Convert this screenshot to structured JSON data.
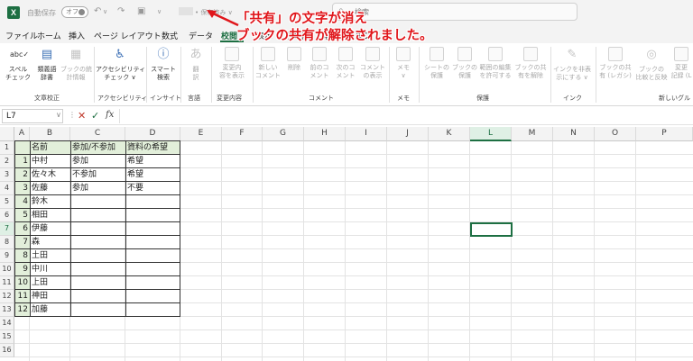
{
  "titlebar": {
    "app_letter": "X",
    "autosave_label": "自動保存",
    "autosave_state": "オフ",
    "save_status": "• 保存済み ∨",
    "search_placeholder": "検索"
  },
  "tabs": [
    "ファイル",
    "ホーム",
    "挿入",
    "ページ レイアウト",
    "数式",
    "データ",
    "校閲",
    "表示",
    "自動化",
    "開発",
    "ヘルプ"
  ],
  "active_tab": "校閲",
  "ribbon": {
    "spell": "スペル\nチェック",
    "thesaurus": "類義語\n辞書",
    "workbook_stats": "ブックの統\n計情報",
    "accessibility": "アクセシビリティ\nチェック ∨",
    "smart_lookup": "スマート\n検索",
    "translate": "翻\n訳",
    "show_changes": "変更内\n容を表示",
    "new_comment": "新しい\nコメント",
    "delete": "削除",
    "prev_comment": "前のコ\nメント",
    "next_comment": "次のコ\nメント",
    "show_comments": "コメント\nの表示",
    "notes": "メモ\n∨",
    "protect_sheet": "シートの\n保護",
    "protect_workbook": "ブックの\n保護",
    "allow_edit_ranges": "範囲の編集\nを許可する",
    "unshare_workbook": "ブックの共\n有を解除",
    "hide_ink": "インクを非表\n示にする ∨",
    "share_legacy": "ブックの共\n有 (レガシ)",
    "compare_merge": "ブックの\n比較と反映",
    "track_changes": "変更\n記録 (L",
    "groups": {
      "proofing": "文章校正",
      "accessibility": "アクセシビリティ",
      "insights": "インサイト",
      "language": "言語",
      "changes": "変更内容",
      "comments": "コメント",
      "notes": "メモ",
      "protect": "保護",
      "ink": "インク",
      "new_group": "新しいグル"
    }
  },
  "formula_bar": {
    "name_box": "L7",
    "fx": "fx",
    "value": ""
  },
  "columns": [
    "A",
    "B",
    "C",
    "D",
    "E",
    "F",
    "G",
    "H",
    "I",
    "J",
    "K",
    "L",
    "M",
    "N",
    "O",
    "P"
  ],
  "selected_column": "L",
  "rows": [
    "1",
    "2",
    "3",
    "4",
    "5",
    "6",
    "7",
    "8",
    "9",
    "10",
    "11",
    "12",
    "13",
    "14",
    "15",
    "16"
  ],
  "selected_row": "7",
  "table": {
    "headers": [
      "名前",
      "参加/不参加",
      "資料の希望"
    ],
    "index": [
      "1",
      "2",
      "3",
      "4",
      "5",
      "6",
      "7",
      "8",
      "9",
      "10",
      "11",
      "12"
    ],
    "rows": [
      [
        "中村",
        "参加",
        "希望"
      ],
      [
        "佐々木",
        "不参加",
        "希望"
      ],
      [
        "佐藤",
        "参加",
        "不要"
      ],
      [
        "鈴木",
        "",
        ""
      ],
      [
        "相田",
        "",
        ""
      ],
      [
        "伊藤",
        "",
        ""
      ],
      [
        "森",
        "",
        ""
      ],
      [
        "土田",
        "",
        ""
      ],
      [
        "中川",
        "",
        ""
      ],
      [
        "上田",
        "",
        ""
      ],
      [
        "神田",
        "",
        ""
      ],
      [
        "加藤",
        "",
        ""
      ]
    ]
  },
  "annotation": {
    "line1": "「共有」の文字が消え",
    "line2": "ブックの共有が解除されました。",
    "color": "#e0161b"
  }
}
